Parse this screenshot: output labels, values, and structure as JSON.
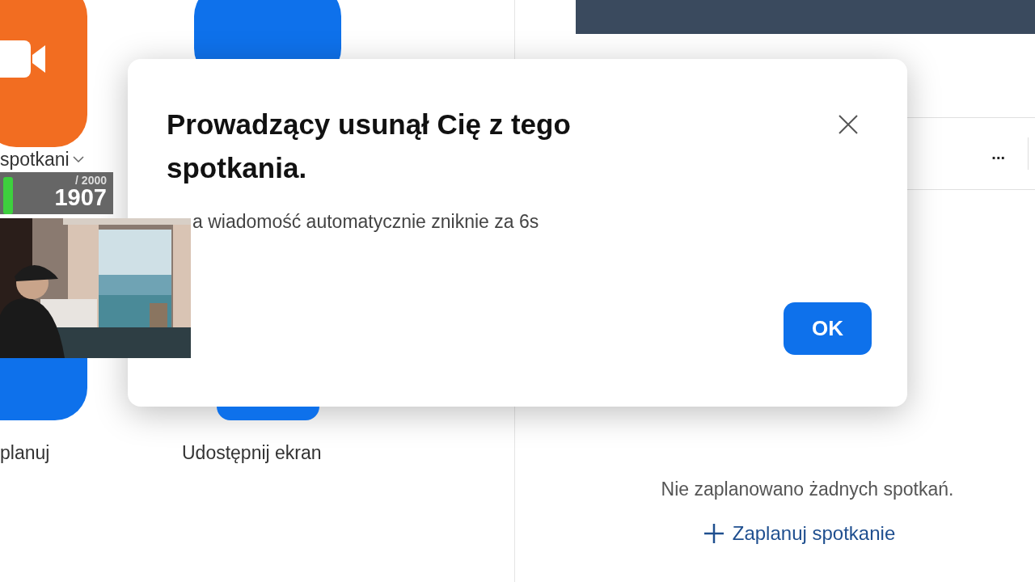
{
  "home": {
    "tiles": [
      {
        "label": "spotkani",
        "color": "#f26d21",
        "dropdown": true
      },
      {
        "label": "planuj",
        "color": "#0e71eb",
        "dropdown": false
      },
      {
        "label": "Udostępnij ekran",
        "color": "#0e71eb",
        "dropdown": false
      }
    ]
  },
  "meetings": {
    "more": "...",
    "empty_message": "Nie zaplanowano żadnych spotkań.",
    "schedule_link": "Zaplanuj spotkanie"
  },
  "dialog": {
    "title": "Prowadzący usunął Cię z tego spotkania.",
    "message": "a wiadomość automatycznie zniknie za 6s",
    "ok": "OK"
  },
  "goal_counter": {
    "target": "/ 2000",
    "value": "1907"
  }
}
